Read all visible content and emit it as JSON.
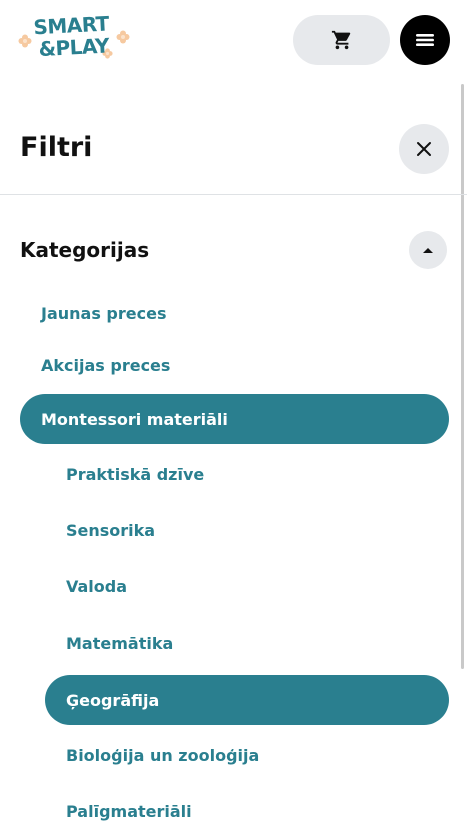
{
  "header": {
    "logo_line1": "SMART",
    "logo_line2": "&PLAY",
    "cart_icon": "cart-icon",
    "menu_icon": "hamburger-icon"
  },
  "filters": {
    "title": "Filtri",
    "close_icon": "close-icon",
    "section_title": "Kategorijas",
    "collapse_icon": "caret-up-icon",
    "categories": [
      {
        "label": "Jaunas preces",
        "level": 1,
        "active": false
      },
      {
        "label": "Akcijas preces",
        "level": 1,
        "active": false
      },
      {
        "label": "Montessori materiāli",
        "level": 1,
        "active": true
      },
      {
        "label": "Praktiskā dzīve",
        "level": 2,
        "active": false
      },
      {
        "label": "Sensorika",
        "level": 2,
        "active": false
      },
      {
        "label": "Valoda",
        "level": 2,
        "active": false
      },
      {
        "label": "Matemātika",
        "level": 2,
        "active": false
      },
      {
        "label": "Ģeogrāfija",
        "level": 2,
        "active": true
      },
      {
        "label": "Bioloģija un zooloģija",
        "level": 2,
        "active": false
      },
      {
        "label": "Palīgmateriāli",
        "level": 2,
        "active": false
      }
    ]
  },
  "colors": {
    "accent": "#2a7f8f",
    "button_bg": "#e7e9ec",
    "logo_flower": "#f6c9a0"
  }
}
